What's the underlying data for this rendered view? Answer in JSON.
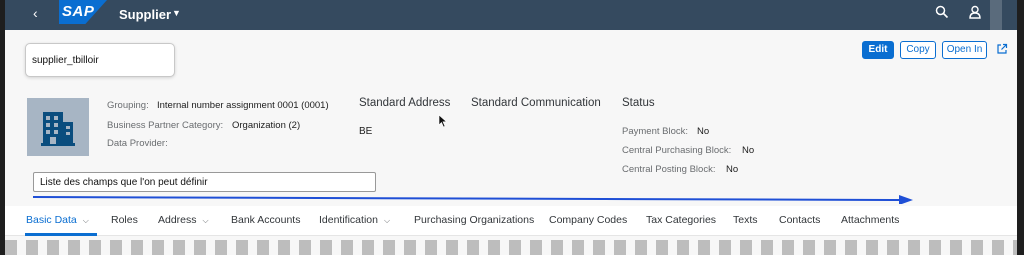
{
  "shell": {
    "app_title": "Supplier",
    "logo_text": "SAP"
  },
  "header": {
    "id_value": "supplier_tbilloir",
    "buttons": {
      "edit": "Edit",
      "copy": "Copy",
      "open_in": "Open In"
    },
    "fields": {
      "grouping_label": "Grouping:",
      "grouping_value": "Internal number assignment 0001 (0001)",
      "bp_category_label": "Business Partner Category:",
      "bp_category_value": "Organization (2)",
      "data_provider_label": "Data Provider:"
    },
    "sections": {
      "standard_address": "Standard Address",
      "address_value": "BE",
      "standard_communication": "Standard Communication",
      "status": "Status"
    },
    "status_fields": {
      "payment_block_label": "Payment Block:",
      "payment_block_value": "No",
      "purchasing_block_label": "Central Purchasing Block:",
      "purchasing_block_value": "No",
      "posting_block_label": "Central Posting Block:",
      "posting_block_value": "No"
    },
    "annotation": "Liste des champs que l'on peut définir"
  },
  "tabs": [
    {
      "label": "Basic Data"
    },
    {
      "label": "Roles"
    },
    {
      "label": "Address"
    },
    {
      "label": "Bank Accounts"
    },
    {
      "label": "Identification"
    },
    {
      "label": "Purchasing Organizations"
    },
    {
      "label": "Company Codes"
    },
    {
      "label": "Tax Categories"
    },
    {
      "label": "Texts"
    },
    {
      "label": "Contacts"
    },
    {
      "label": "Attachments"
    }
  ],
  "colors": {
    "shell": "#354a5f",
    "accent": "#0a6ed1",
    "avatar": "#a7b5c4"
  },
  "icons": [
    "back-icon",
    "search-icon",
    "user-icon",
    "external-link-icon",
    "building-icon",
    "chevron-down-icon"
  ]
}
